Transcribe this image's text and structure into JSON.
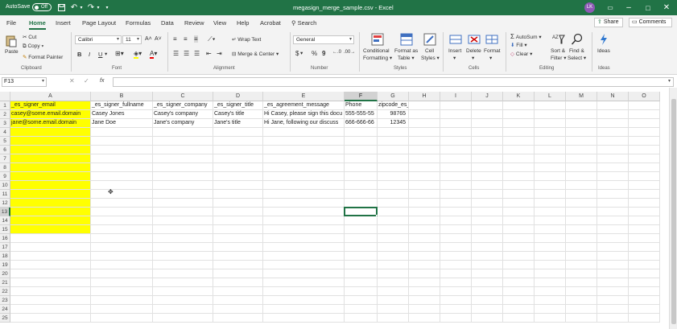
{
  "titlebar": {
    "autosave_label": "AutoSave",
    "autosave_state": "Off",
    "file_title": "megasign_merge_sample.csv  -  Excel",
    "user_initials": "LK"
  },
  "tabs": [
    "File",
    "Home",
    "Insert",
    "Page Layout",
    "Formulas",
    "Data",
    "Review",
    "View",
    "Help",
    "Acrobat"
  ],
  "search_label": "Search",
  "share_label": "Share",
  "comments_label": "Comments",
  "ribbon": {
    "clipboard": {
      "paste": "Paste",
      "cut": "Cut",
      "copy": "Copy",
      "format_painter": "Format Painter",
      "label": "Clipboard"
    },
    "font": {
      "name": "Calibri",
      "size": "11",
      "bold": "B",
      "italic": "I",
      "underline": "U",
      "label": "Font"
    },
    "alignment": {
      "wrap_text": "Wrap Text",
      "merge_center": "Merge & Center",
      "label": "Alignment"
    },
    "number": {
      "format": "General",
      "currency": "$",
      "percent": "%",
      "comma": "9",
      "label": "Number"
    },
    "styles": {
      "conditional": "Conditional",
      "formatting": "Formatting",
      "format_as": "Format as",
      "table": "Table",
      "cell": "Cell",
      "cell_styles": "Styles",
      "label": "Styles"
    },
    "cells": {
      "insert": "Insert",
      "delete": "Delete",
      "format": "Format",
      "label": "Cells"
    },
    "editing": {
      "autosum": "AutoSum",
      "fill": "Fill",
      "clear": "Clear",
      "sort": "Sort &",
      "filter": "Filter",
      "find": "Find &",
      "select": "Select",
      "label": "Editing"
    },
    "ideas": {
      "label": "Ideas",
      "button": "Ideas"
    }
  },
  "formula_bar": {
    "name_box": "F13",
    "fx": "fx",
    "content": ""
  },
  "columns": [
    "A",
    "B",
    "C",
    "D",
    "E",
    "F",
    "G",
    "H",
    "I",
    "J",
    "K",
    "L",
    "M",
    "N",
    "O"
  ],
  "rows": [
    "1",
    "2",
    "3",
    "4",
    "5",
    "6",
    "7",
    "8",
    "9",
    "10",
    "11",
    "12",
    "13",
    "14",
    "15",
    "16",
    "17",
    "18",
    "19",
    "20",
    "21",
    "22",
    "23",
    "24",
    "25"
  ],
  "sheet": [
    [
      "_es_signer_email",
      "_es_signer_fullname",
      "_es_signer_company",
      "_es_signer_title",
      "_es_agreement_message",
      "Phone",
      "zipcode_es_signer"
    ],
    [
      "casey@some.email.domain",
      "Casey Jones",
      "Casey's company",
      "Casey's title",
      "Hi Casey, please sign this docu",
      "555-555-55",
      "98765"
    ],
    [
      "jane@some.email.domain",
      "Jane Doe",
      "Jane's company",
      "Jane's title",
      "Hi Jane, following our discuss",
      "666-666-66",
      "12345"
    ]
  ],
  "highlight_color": "#ffff00",
  "accent_color": "#217346"
}
